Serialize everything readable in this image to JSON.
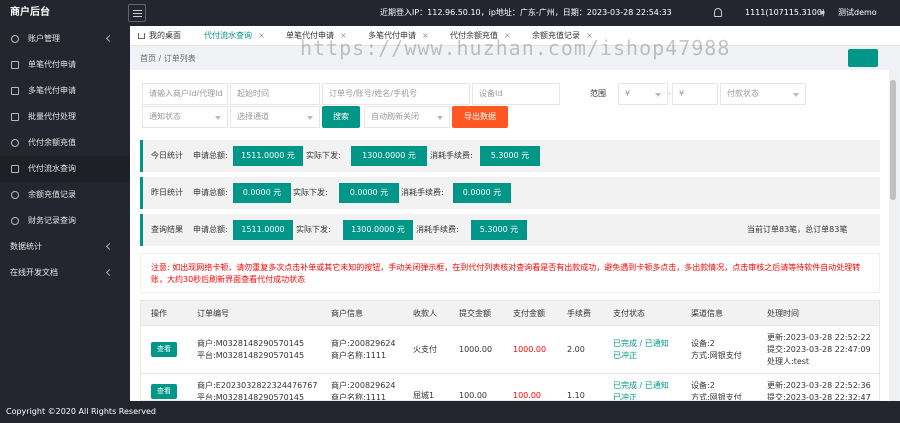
{
  "brand": "商户后台",
  "topbar": {
    "info": "近期登入IP：112.96.50.10，ip地址：广东-广州，日期：2023-03-28 22:54:33",
    "user": "1111(107115.3100)",
    "logout": "测试demo"
  },
  "sidebar": {
    "items": [
      {
        "label": "账户管理",
        "icon": "user-icon"
      },
      {
        "label": "单笔代付申请",
        "icon": "doc-icon"
      },
      {
        "label": "多笔代付申请",
        "icon": "copy-icon"
      },
      {
        "label": "批量代付处理",
        "icon": "print-icon"
      },
      {
        "label": "代付余额充值",
        "icon": "dollar-icon"
      },
      {
        "label": "代付流水查询",
        "icon": "shield-icon"
      },
      {
        "label": "余额充值记录",
        "icon": "coin-icon"
      },
      {
        "label": "财务记录查询",
        "icon": "check-icon"
      }
    ],
    "sections": [
      "数据统计",
      "在线开发文档"
    ]
  },
  "tabs": [
    {
      "label": "我的桌面"
    },
    {
      "label": "代付流水查询"
    },
    {
      "label": "单笔代付申请"
    },
    {
      "label": "多笔代付申请"
    },
    {
      "label": "代付余额充值"
    },
    {
      "label": "余额充值记录"
    }
  ],
  "breadcrumb": "首页  /  订单列表",
  "filters": {
    "merchant_placeholder": "请输入商户Id/代理Id",
    "start_placeholder": "起始时间",
    "end_placeholder": "结束时间",
    "order_placeholder": "订单号/账号/姓名/手机号",
    "device_placeholder": "设备Id",
    "range_label": "范围",
    "min_placeholder": "¥",
    "dash": "-",
    "max_placeholder": "¥",
    "pay_status": "付款状态",
    "notify_status": "通知状态",
    "channel": "选择通道",
    "search": "搜索",
    "auto_refresh": "自动刷新关闭",
    "export": "导出数据"
  },
  "stats": {
    "today": {
      "title": "今日统计",
      "apply_label": "申请总额:",
      "apply": "1511.0000 元",
      "paid_label": "实际下发:",
      "paid": "1300.0000 元",
      "fee_label": "消耗手续费:",
      "fee": "5.3000 元"
    },
    "yesterday": {
      "title": "昨日统计",
      "apply_label": "申请总额:",
      "apply": "0.0000 元",
      "paid_label": "实际下发:",
      "paid": "0.0000 元",
      "fee_label": "消耗手续费:",
      "fee": "0.0000 元"
    },
    "query": {
      "title": "查询结果",
      "apply_label": "申请总额:",
      "apply": "1511.0000",
      "paid_label": "实际下发:",
      "paid": "1300.0000 元",
      "fee_label": "消耗手续费:",
      "fee": "5.3000 元",
      "summary": "当前订单83笔，总订单83笔"
    }
  },
  "notice": "注意: 如出现网络卡顿，请勿重复多次点击补单或其它未知的按钮，手动关闭弹示框，在到代付列表核对查询看是否有出款成功，避免遇到卡顿多点击，多出款情况，点击审核之后请等待软件自动处理转账，大约30秒后刷新界面查看代付成功状态",
  "table": {
    "headers": [
      "操作",
      "订单编号",
      "商户信息",
      "收款人",
      "提交金额",
      "支付金额",
      "手续费",
      "支付状态",
      "渠道信息",
      "处理时间"
    ],
    "view_label": "查看",
    "rows": [
      {
        "order1": "商户:M0328148290570145",
        "order2": "平台:M0328148290570145",
        "merchant1": "商户:200829624",
        "merchant2": "商户名称:1111",
        "payee": "火支付",
        "submit": "1000.00",
        "paid": "1000.00",
        "fee": "2.00",
        "status1": "已完成 / 已通知",
        "status2": "已冲正",
        "channel1": "设备:2",
        "channel2": "方式:网银支付",
        "time1": "更新:2023-03-28 22:52:22",
        "time2": "提交:2023-03-28 22:47:09",
        "time3": "处理人:test"
      },
      {
        "order1": "商户:E2023032822324476767",
        "order2": "平台:M0328148290570145",
        "merchant1": "商户:200829624",
        "merchant2": "商户名称:1111",
        "payee": "屈城1",
        "submit": "100.00",
        "paid": "100.00",
        "fee": "1.10",
        "status1": "已完成 / 已通知",
        "status2": "已冲正",
        "channel1": "设备:2",
        "channel2": "方式:网银支付",
        "time1": "更新:2023-03-28 22:52:36",
        "time2": "提交:2023-03-28 22:32:47",
        "time3": ""
      }
    ]
  },
  "footer": "Copyright ©2020 All Rights Reserved",
  "watermark": "https://www.huzhan.com/ishop47988"
}
